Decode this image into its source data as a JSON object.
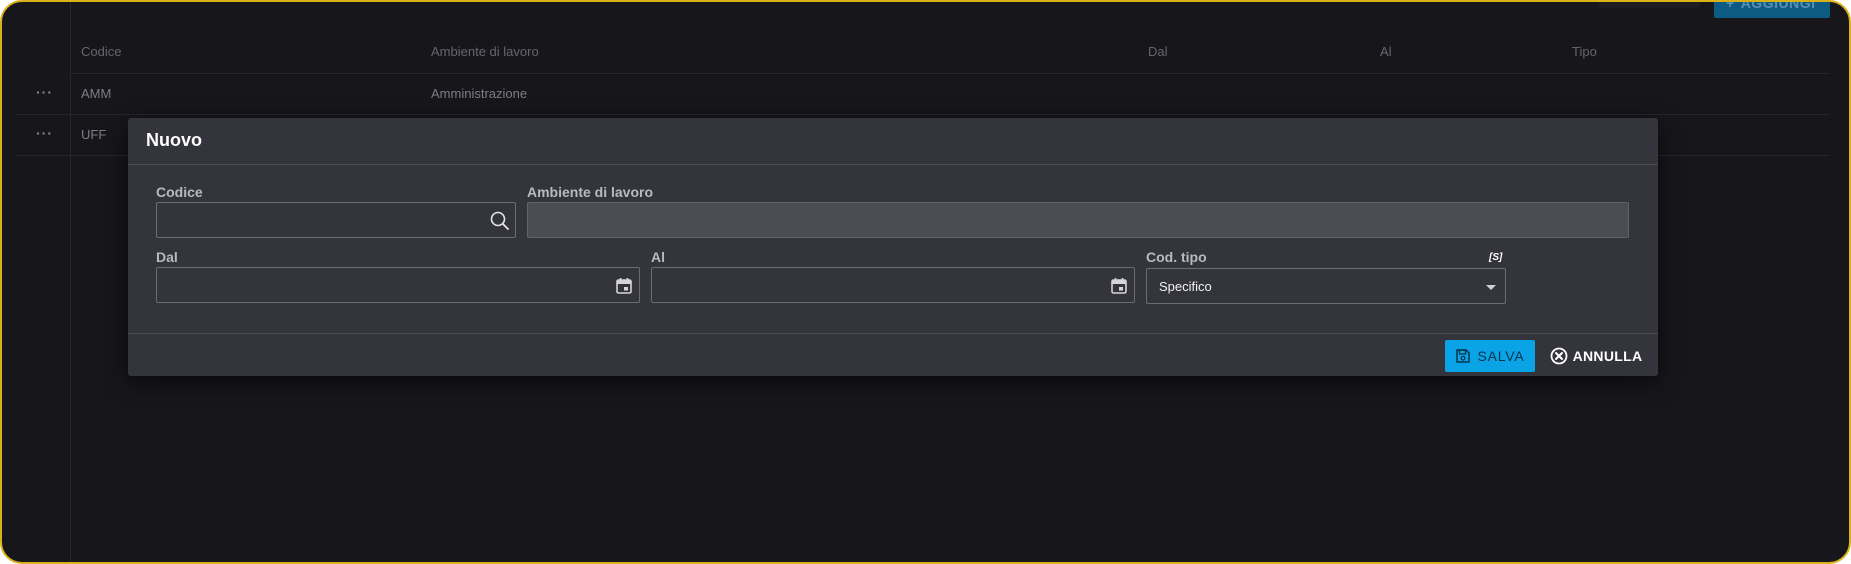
{
  "toolbar": {
    "add_label": "AGGIUNGI"
  },
  "grid": {
    "columns": [
      "Codice",
      "Ambiente di lavoro",
      "Dal",
      "Al",
      "Tipo"
    ],
    "rows": [
      {
        "menu": "···",
        "codice": "AMM",
        "ambiente": "Amministrazione"
      },
      {
        "menu": "···",
        "codice": "UFF",
        "ambiente": ""
      }
    ]
  },
  "dialog": {
    "title": "Nuovo",
    "fields": {
      "codice": {
        "label": "Codice",
        "value": ""
      },
      "ambiente": {
        "label": "Ambiente di lavoro",
        "value": ""
      },
      "dal": {
        "label": "Dal",
        "value": ""
      },
      "al": {
        "label": "Al",
        "value": ""
      },
      "cod_tipo": {
        "label": "Cod. tipo",
        "value": "Specifico",
        "badge": "[S]"
      }
    },
    "buttons": {
      "save": "SALVA",
      "cancel": "ANNULLA"
    }
  },
  "icons": {
    "search": "search-icon",
    "calendar": "calendar-icon",
    "save": "save-icon",
    "cancel": "close-circle-icon",
    "add": "plus-icon"
  },
  "colors": {
    "accent": "#0aa4e6",
    "frame_border": "#d9b21a",
    "background": "#16161b",
    "dialog_bg": "#34343c"
  }
}
